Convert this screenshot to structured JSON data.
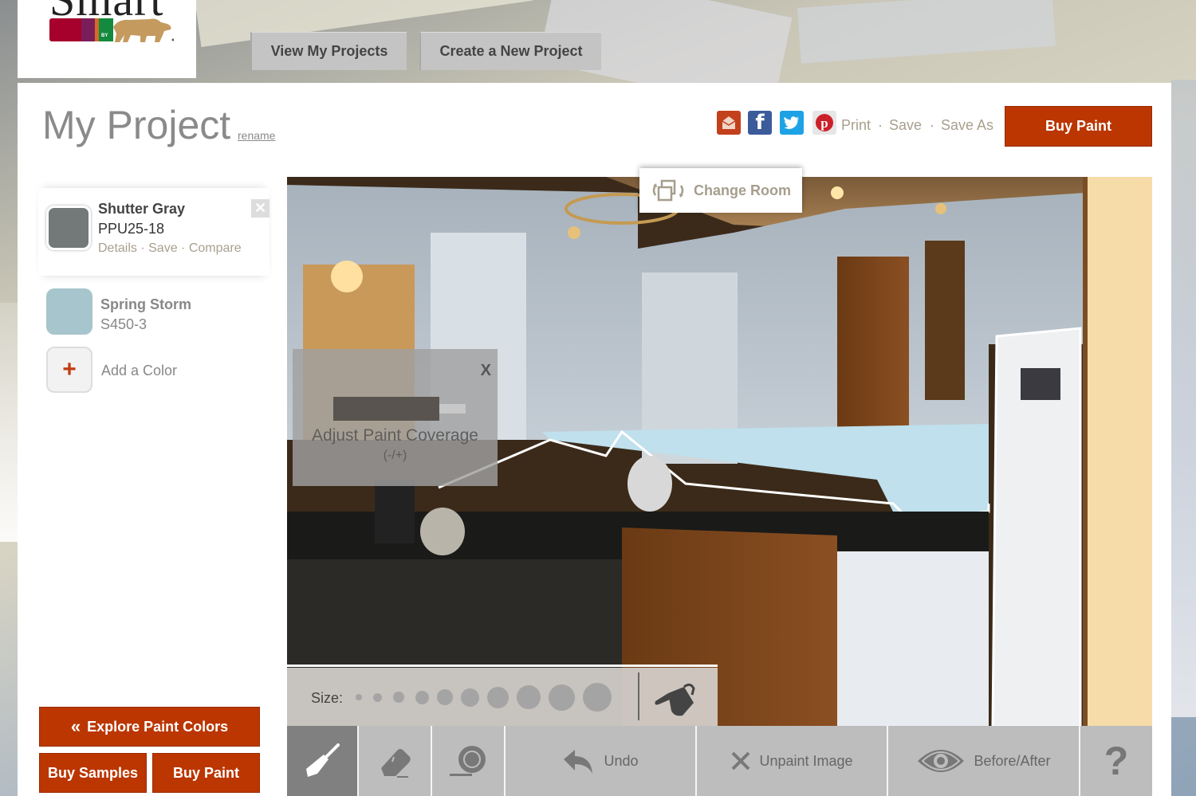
{
  "brand": {
    "logo_word": "Smart",
    "logo_by": "BY"
  },
  "nav": {
    "view_projects": "View My Projects",
    "create_project": "Create a New Project"
  },
  "project": {
    "title": "My Project",
    "rename": "rename"
  },
  "share": {
    "icons": [
      "email-icon",
      "facebook-icon",
      "twitter-icon",
      "pinterest-icon"
    ],
    "facebook_glyph": "f",
    "print": "Print",
    "save": "Save",
    "save_as": "Save As",
    "separator": "·",
    "buy_paint": "Buy Paint"
  },
  "colors": {
    "items": [
      {
        "name": "Shutter Gray",
        "code": "PPU25-18",
        "hex": "#737979",
        "active": true,
        "links": [
          "Details",
          "Save",
          "Compare"
        ]
      },
      {
        "name": "Spring Storm",
        "code": "S450-3",
        "hex": "#a7c5cc",
        "active": false
      }
    ],
    "remove_glyph": "✕",
    "add_glyph": "+",
    "add_label": "Add a Color",
    "link_separator": " · "
  },
  "left_actions": {
    "explore": "Explore Paint Colors",
    "explore_icon": "«",
    "buy_samples": "Buy Samples",
    "buy_paint": "Buy Paint"
  },
  "canvas": {
    "change_room": "Change Room",
    "coverage": {
      "label": "Adjust Paint Coverage",
      "hint": "(-/+)",
      "close": "X",
      "value_fraction": 0.8
    }
  },
  "brush_size": {
    "label": "Size:",
    "options": 10,
    "selected_index": null
  },
  "toolbar": {
    "tools": [
      {
        "id": "brush",
        "icon": "paint-brush-icon",
        "active": true
      },
      {
        "id": "eraser",
        "icon": "eraser-icon",
        "active": false
      },
      {
        "id": "tape",
        "icon": "tape-icon",
        "active": false
      }
    ],
    "undo": "Undo",
    "unpaint": "Unpaint Image",
    "before_after": "Before/After",
    "help": "?"
  },
  "theme": {
    "accent": "#bb3600",
    "link_color": "#a89f8e",
    "toolbar_bg": "#bdbdbd",
    "toolbar_active": "#808080"
  }
}
